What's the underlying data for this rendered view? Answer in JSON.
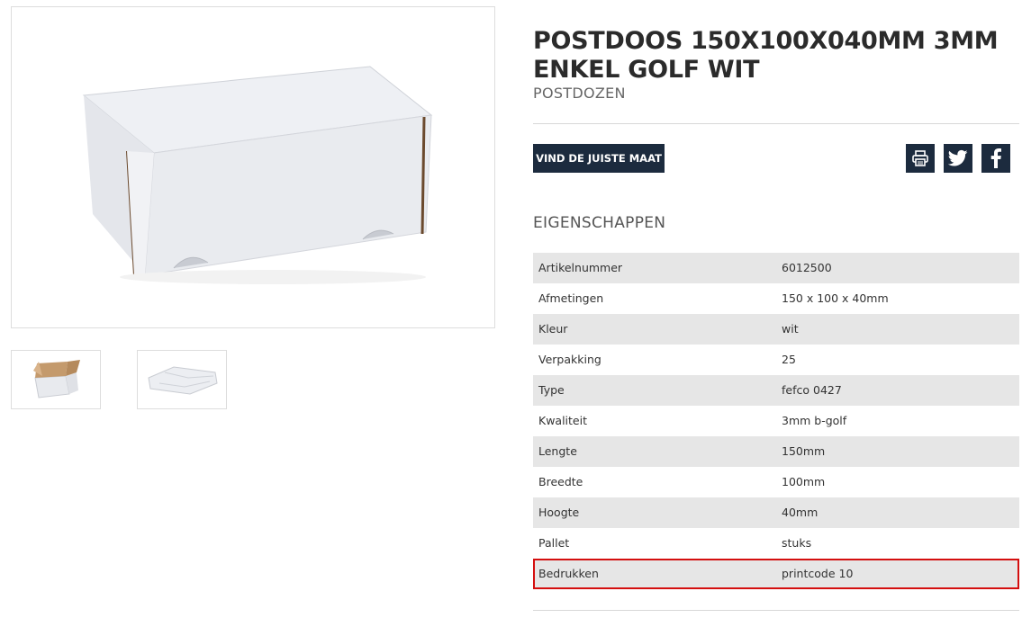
{
  "product": {
    "title": "POSTDOOS 150X100X040MM 3MM ENKEL GOLF WIT",
    "category": "POSTDOZEN",
    "main_image_icon": "white-shipping-box-image",
    "thumbnails": [
      {
        "icon": "open-box-thumbnail"
      },
      {
        "icon": "flat-box-die-cut-thumbnail"
      }
    ]
  },
  "actions": {
    "find_size_label": "VIND DE JUISTE MAAT",
    "print_icon": "print-icon",
    "twitter_icon": "twitter-icon",
    "facebook_icon": "facebook-icon"
  },
  "properties": {
    "section_title": "EIGENSCHAPPEN",
    "rows": [
      {
        "key": "Artikelnummer",
        "value": "6012500"
      },
      {
        "key": "Afmetingen",
        "value": "150 x 100 x 40mm"
      },
      {
        "key": "Kleur",
        "value": "wit"
      },
      {
        "key": "Verpakking",
        "value": "25"
      },
      {
        "key": "Type",
        "value": "fefco 0427"
      },
      {
        "key": "Kwaliteit",
        "value": "3mm b-golf"
      },
      {
        "key": "Lengte",
        "value": "150mm"
      },
      {
        "key": "Breedte",
        "value": "100mm"
      },
      {
        "key": "Hoogte",
        "value": "40mm"
      },
      {
        "key": "Pallet",
        "value": "stuks"
      },
      {
        "key": "Bedrukken",
        "value": "printcode 10"
      }
    ],
    "highlight_color": "#d40f0f"
  },
  "colors": {
    "button_bg": "#1c2b3e",
    "row_alt_bg": "#e6e6e6"
  }
}
